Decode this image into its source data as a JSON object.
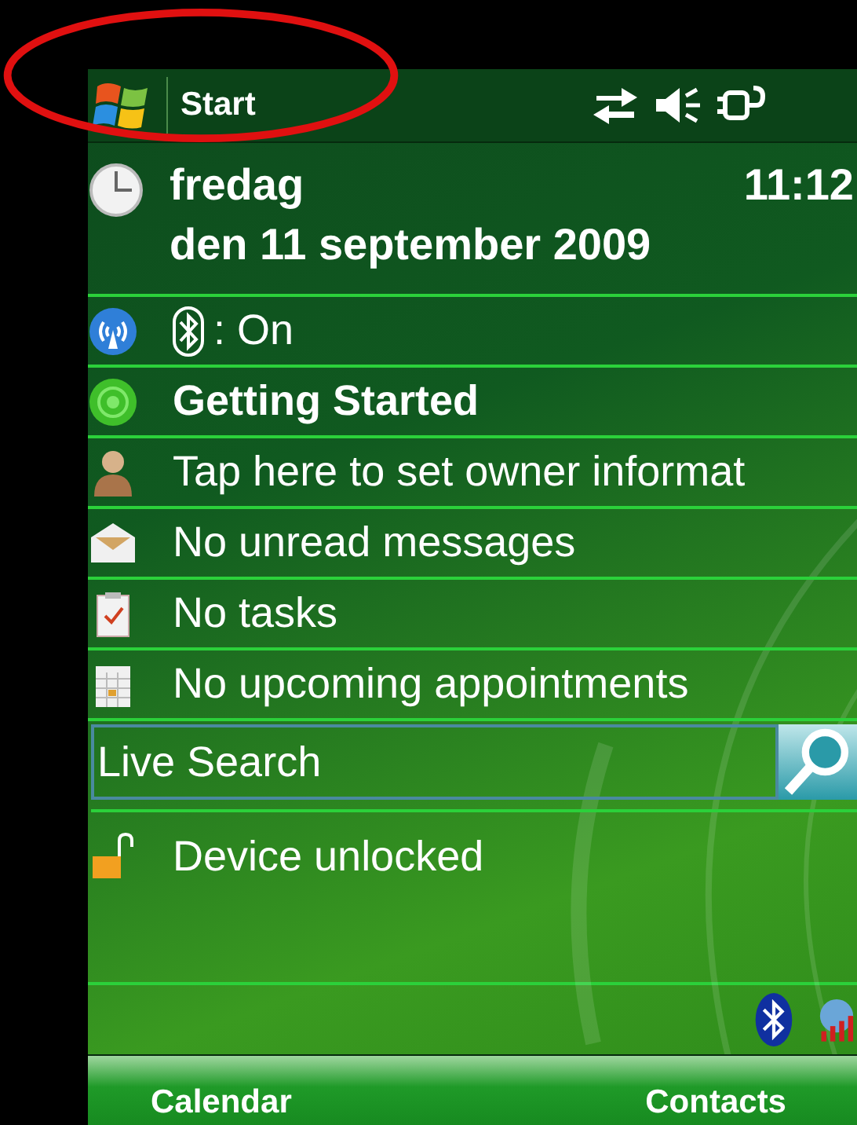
{
  "title_bar": {
    "start_label": "Start"
  },
  "today": {
    "day": "fredag",
    "time": "11:12",
    "date": "den 11 september 2009"
  },
  "items": [
    {
      "kind": "wireless",
      "text": ": On",
      "bold": false
    },
    {
      "kind": "getting_started",
      "text": "Getting Started",
      "bold": true
    },
    {
      "kind": "owner",
      "text": "Tap here to set owner informat",
      "bold": false
    },
    {
      "kind": "messages",
      "text": "No unread messages",
      "bold": false
    },
    {
      "kind": "tasks",
      "text": "No tasks",
      "bold": false
    },
    {
      "kind": "appointments",
      "text": "No upcoming appointments",
      "bold": false
    }
  ],
  "search": {
    "placeholder": "Live Search"
  },
  "lock": {
    "text": "Device unlocked"
  },
  "softkeys": [
    "Calendar",
    "Contacts"
  ]
}
